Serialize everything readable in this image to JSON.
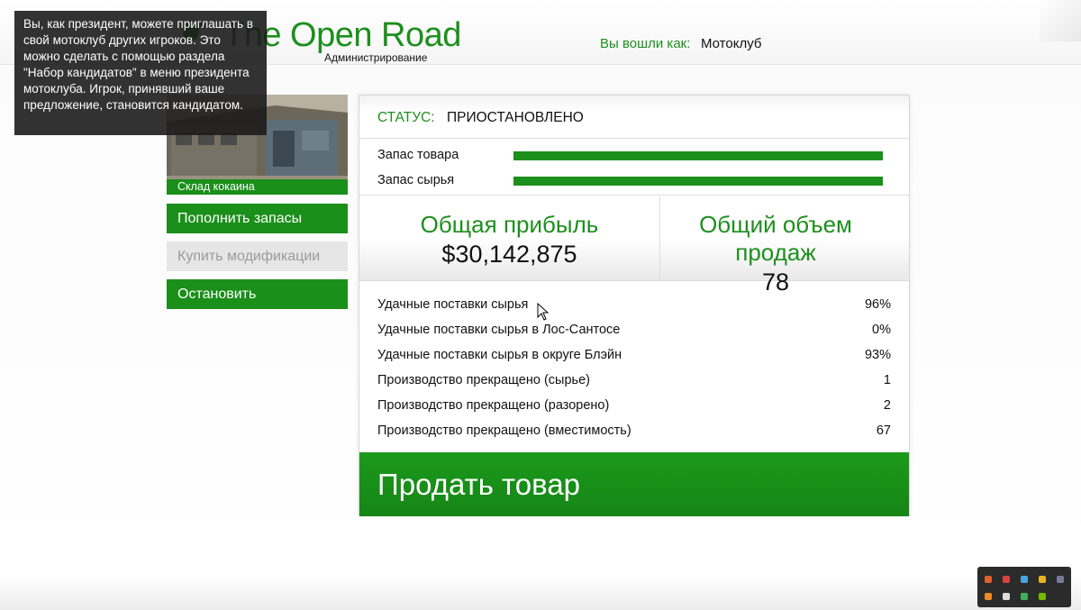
{
  "tooltip": {
    "text": "Вы, как президент, можете приглашать в свой мотоклуб других игроков. Это можно сделать с помощью раздела \"Набор кандидатов\" в меню президента мотоклуба. Игрок, принявший ваше предложение, становится кандидатом."
  },
  "header": {
    "title": "The Open Road",
    "subtitle": "Администрирование",
    "login_label": "Вы вошли как:",
    "login_value": "Мотоклуб"
  },
  "business": {
    "name": "Склад кокаина"
  },
  "menu": {
    "resupply": "Пополнить запасы",
    "upgrades": "Купить модификации",
    "shutdown": "Остановить"
  },
  "status": {
    "label": "СТАТУС:",
    "value": "ПРИОСТАНОВЛЕНО"
  },
  "stock": {
    "product_label": "Запас товара",
    "product_level": 1.0,
    "supplies_label": "Запас сырья",
    "supplies_level": 1.0
  },
  "totals": {
    "earnings_title": "Общая прибыль",
    "earnings_value": "$30,142,875",
    "sales_title": "Общий объем продаж",
    "sales_value": "78"
  },
  "stats": [
    {
      "label": "Удачные поставки сырья",
      "value": "96%"
    },
    {
      "label": "Удачные поставки сырья в Лос-Сантосе",
      "value": "0%"
    },
    {
      "label": "Удачные поставки сырья в округе Блэйн",
      "value": "93%"
    },
    {
      "label": "Производство прекращено (сырье)",
      "value": "1"
    },
    {
      "label": "Производство прекращено (разорено)",
      "value": "2"
    },
    {
      "label": "Производство прекращено (вместимость)",
      "value": "67"
    }
  ],
  "sell_button": "Продать товар",
  "colors": {
    "accent": "#1a8f1a",
    "disabled": "#e6e6e6",
    "tooltip_bg": "#1c1c1c"
  }
}
